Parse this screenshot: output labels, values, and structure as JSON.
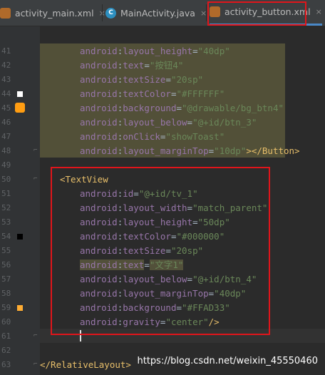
{
  "tabs": [
    {
      "label": "activity_main.xml",
      "icon": "xml-file-icon",
      "close": "×"
    },
    {
      "label": "MainActivity.java",
      "icon": "java-class-icon",
      "icon_letter": "C",
      "close": "×"
    },
    {
      "label": "activity_button.xml",
      "icon": "xml-file-icon",
      "close": "×",
      "active": true
    }
  ],
  "lines": [
    {
      "num": "41"
    },
    {
      "num": "42"
    },
    {
      "num": "43"
    },
    {
      "num": "44"
    },
    {
      "num": "45"
    },
    {
      "num": "46"
    },
    {
      "num": "47"
    },
    {
      "num": "48"
    },
    {
      "num": "49"
    },
    {
      "num": "50"
    },
    {
      "num": "51"
    },
    {
      "num": "52"
    },
    {
      "num": "53"
    },
    {
      "num": "54"
    },
    {
      "num": "55"
    },
    {
      "num": "56"
    },
    {
      "num": "57"
    },
    {
      "num": "58"
    },
    {
      "num": "59"
    },
    {
      "num": "60"
    },
    {
      "num": "61"
    },
    {
      "num": "62"
    },
    {
      "num": "63"
    }
  ],
  "code": {
    "l41": {
      "attr": "layout_height",
      "val": "\"40dp\""
    },
    "l42": {
      "attr": "text",
      "val": "\"按钮4\""
    },
    "l43": {
      "attr": "textSize",
      "val": "\"20sp\""
    },
    "l44": {
      "attr": "textColor",
      "val": "\"#FFFFFF\""
    },
    "l45": {
      "attr": "background",
      "val": "\"@drawable/bg_btn4\""
    },
    "l46": {
      "attr": "layout_below",
      "val": "\"@+id/btn_3\""
    },
    "l47": {
      "attr": "onClick",
      "val": "\"showToast\""
    },
    "l48": {
      "attr": "layout_marginTop",
      "val": "\"10dp\"",
      "close": "></Button>"
    },
    "l50": {
      "tag": "<TextView"
    },
    "l51": {
      "attr": "id",
      "val": "\"@+id/tv_1\""
    },
    "l52": {
      "attr": "layout_width",
      "val": "\"match_parent\""
    },
    "l53": {
      "attr": "layout_height",
      "val": "\"50dp\""
    },
    "l54": {
      "attr": "textColor",
      "val": "\"#000000\""
    },
    "l55": {
      "attr": "textSize",
      "val": "\"20sp\""
    },
    "l56": {
      "attr": "text",
      "val": "\"文字1\""
    },
    "l57": {
      "attr": "layout_below",
      "val": "\"@+id/btn_4\""
    },
    "l58": {
      "attr": "layout_marginTop",
      "val": "\"40dp\""
    },
    "l59": {
      "attr": "background",
      "val": "\"#FFAD33\""
    },
    "l60": {
      "attr": "gravity",
      "val": "\"center\"",
      "close": "/>"
    },
    "l63": {
      "tag": "</RelativeLayout>"
    }
  },
  "ns": "android",
  "colon": ":",
  "watermark": "https://blog.csdn.net/weixin_45550460",
  "colors": {
    "accent": "#4a88c7",
    "annotation_red": "#e0151b",
    "swatch_white": "#FFFFFF",
    "swatch_black": "#000000",
    "swatch_orange": "#FFAD33"
  }
}
